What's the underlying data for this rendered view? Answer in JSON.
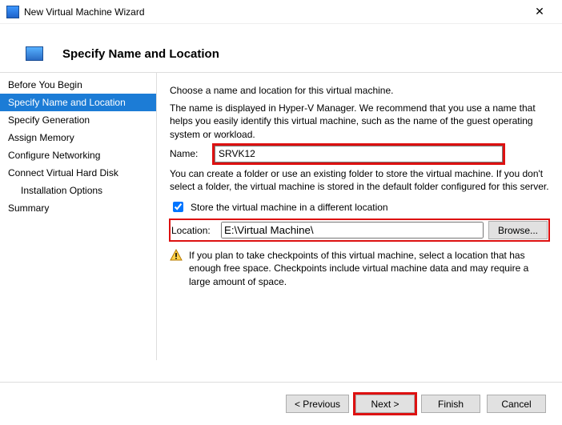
{
  "window": {
    "title": "New Virtual Machine Wizard"
  },
  "header": {
    "title": "Specify Name and Location"
  },
  "sidebar": {
    "steps": [
      "Before You Begin",
      "Specify Name and Location",
      "Specify Generation",
      "Assign Memory",
      "Configure Networking",
      "Connect Virtual Hard Disk",
      "Installation Options",
      "Summary"
    ]
  },
  "main": {
    "intro": "Choose a name and location for this virtual machine.",
    "desc": "The name is displayed in Hyper-V Manager. We recommend that you use a name that helps you easily identify this virtual machine, such as the name of the guest operating system or workload.",
    "name_label": "Name:",
    "name_value": "SRVK12",
    "folder_desc": "You can create a folder or use an existing folder to store the virtual machine. If you don't select a folder, the virtual machine is stored in the default folder configured for this server.",
    "store_chk": "Store the virtual machine in a different location",
    "location_label": "Location:",
    "location_value": "E:\\Virtual Machine\\",
    "browse_label": "Browse...",
    "warn_text": "If you plan to take checkpoints of this virtual machine, select a location that has enough free space. Checkpoints include virtual machine data and may require a large amount of space."
  },
  "footer": {
    "previous": "< Previous",
    "next": "Next >",
    "finish": "Finish",
    "cancel": "Cancel"
  }
}
